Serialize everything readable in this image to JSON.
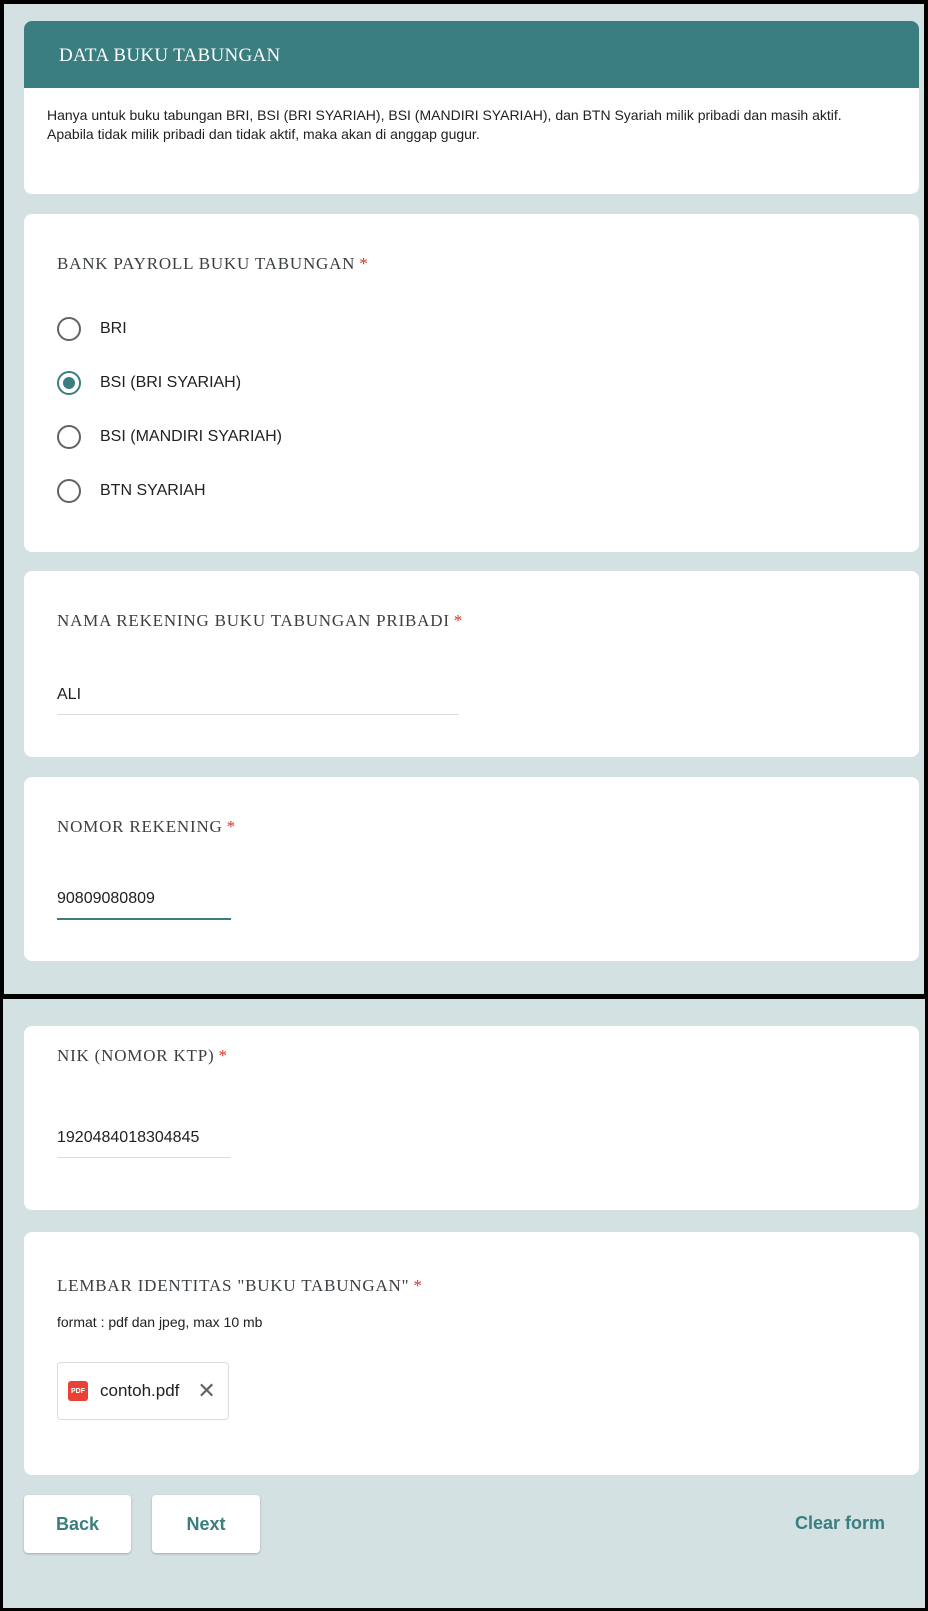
{
  "section": {
    "title": "DATA BUKU TABUNGAN",
    "description": "Hanya untuk buku tabungan BRI, BSI (BRI SYARIAH), BSI (MANDIRI SYARIAH), dan BTN Syariah milik pribadi dan masih aktif. Apabila tidak milik pribadi dan tidak aktif, maka akan di anggap gugur."
  },
  "questions": {
    "bank": {
      "title": "BANK PAYROLL BUKU TABUNGAN",
      "required": "*",
      "options": [
        "BRI",
        "BSI (BRI SYARIAH)",
        "BSI (MANDIRI SYARIAH)",
        "BTN SYARIAH"
      ],
      "selected": "BSI (BRI SYARIAH)"
    },
    "nama": {
      "title": "NAMA REKENING BUKU TABUNGAN PRIBADI",
      "required": "*",
      "value": "ALI"
    },
    "nomor": {
      "title": "NOMOR REKENING",
      "required": "*",
      "value": "90809080809"
    },
    "nik": {
      "title": "NIK (NOMOR KTP)",
      "required": "*",
      "value": "1920484018304845"
    },
    "file": {
      "title": "LEMBAR IDENTITAS \"BUKU TABUNGAN\"",
      "required": "*",
      "hint": "format : pdf dan jpeg, max 10 mb",
      "file_name": "contoh.pdf",
      "file_icon_text": "PDF",
      "remove_symbol": "✕"
    }
  },
  "footer": {
    "back_label": "Back",
    "next_label": "Next",
    "clear_label": "Clear form"
  },
  "colors": {
    "accent": "#3b7e80",
    "background": "#d4e1e3",
    "required": "#d93025"
  }
}
